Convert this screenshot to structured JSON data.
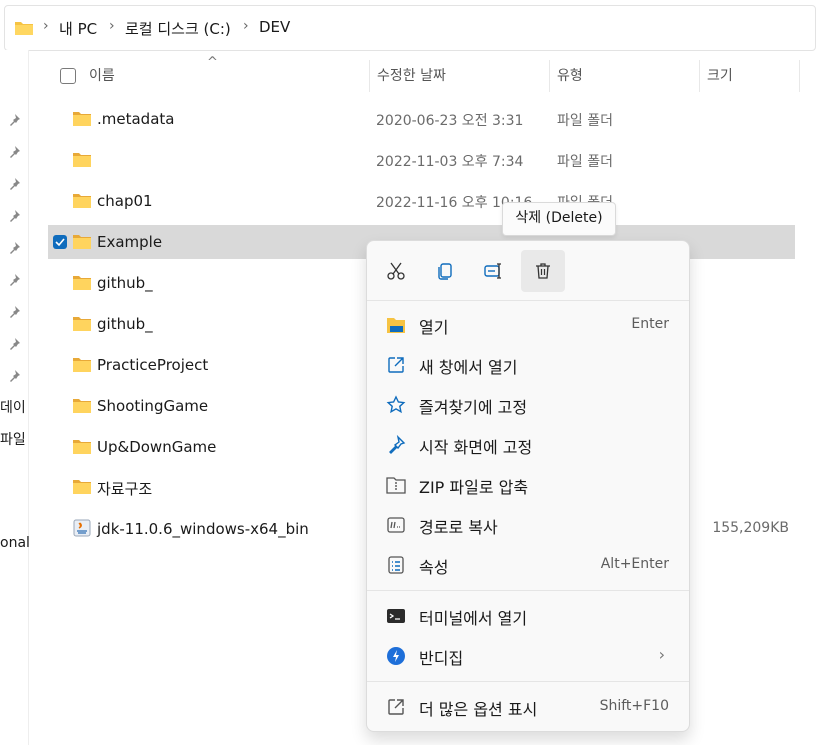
{
  "address_bar": {
    "crumbs": [
      "내 PC",
      "로컬 디스크 (C:)",
      "DEV"
    ],
    "separator": "›"
  },
  "left_panel": {
    "partial_texts": [
      "데이",
      "파일",
      "onal"
    ]
  },
  "columns": {
    "name": "이름",
    "date": "수정한 날짜",
    "type": "유형",
    "size": "크기"
  },
  "files": [
    {
      "name": ".metadata",
      "date": "2020-06-23 오전 3:31",
      "type": "파일 폴더",
      "size": "",
      "icon": "folder-icon"
    },
    {
      "name": "",
      "date": "2022-11-03 오후 7:34",
      "type": "파일 폴더",
      "size": "",
      "icon": "folder-icon"
    },
    {
      "name": "chap01",
      "date": "2022-11-16 오후 10:16",
      "type": "파일 폴더",
      "size": "",
      "icon": "folder-icon"
    },
    {
      "name": "Example",
      "date": "",
      "type": "",
      "size": "",
      "icon": "folder-icon",
      "selected": true
    },
    {
      "name": "github_",
      "date": "",
      "type": "",
      "size": "",
      "icon": "folder-icon"
    },
    {
      "name": "github_",
      "date": "",
      "type": "",
      "size": "",
      "icon": "folder-icon"
    },
    {
      "name": "PracticeProject",
      "date": "",
      "type": "",
      "size": "",
      "icon": "folder-icon"
    },
    {
      "name": "ShootingGame",
      "date": "",
      "type": "",
      "size": "",
      "icon": "folder-icon"
    },
    {
      "name": "Up&DownGame",
      "date": "",
      "type": "",
      "size": "",
      "icon": "folder-icon"
    },
    {
      "name": "자료구조",
      "date": "",
      "type": "",
      "size": "",
      "icon": "folder-icon"
    },
    {
      "name": "jdk-11.0.6_windows-x64_bin",
      "date": "",
      "type": "",
      "size": "155,209KB",
      "icon": "java-installer-icon"
    }
  ],
  "tooltip": "삭제 (Delete)",
  "context_menu": {
    "toolbar": [
      {
        "name": "cut",
        "icon": "scissors-icon"
      },
      {
        "name": "copy",
        "icon": "copy-icon"
      },
      {
        "name": "rename",
        "icon": "rename-icon"
      },
      {
        "name": "delete",
        "icon": "trash-icon",
        "active": true
      }
    ],
    "items": [
      {
        "label": "열기",
        "shortcut": "Enter",
        "icon": "folder-open-icon"
      },
      {
        "label": "새 창에서 열기",
        "shortcut": "",
        "icon": "external-link-icon"
      },
      {
        "label": "즐겨찾기에 고정",
        "shortcut": "",
        "icon": "star-icon"
      },
      {
        "label": "시작 화면에 고정",
        "shortcut": "",
        "icon": "pin-icon"
      },
      {
        "label": "ZIP 파일로 압축",
        "shortcut": "",
        "icon": "zip-icon"
      },
      {
        "label": "경로로 복사",
        "shortcut": "",
        "icon": "copy-path-icon"
      },
      {
        "label": "속성",
        "shortcut": "Alt+Enter",
        "icon": "properties-icon"
      },
      {
        "label": "터미널에서 열기",
        "shortcut": "",
        "icon": "terminal-icon"
      },
      {
        "label": "반디집",
        "shortcut": "",
        "icon": "bandizip-icon",
        "submenu_arrow": "›"
      },
      {
        "label": "더 많은 옵션 표시",
        "shortcut": "Shift+F10",
        "icon": "more-options-icon"
      }
    ]
  },
  "colors": {
    "accent": "#0f6cbd",
    "folder": "#f6c343",
    "selection": "#d9d9d9"
  }
}
